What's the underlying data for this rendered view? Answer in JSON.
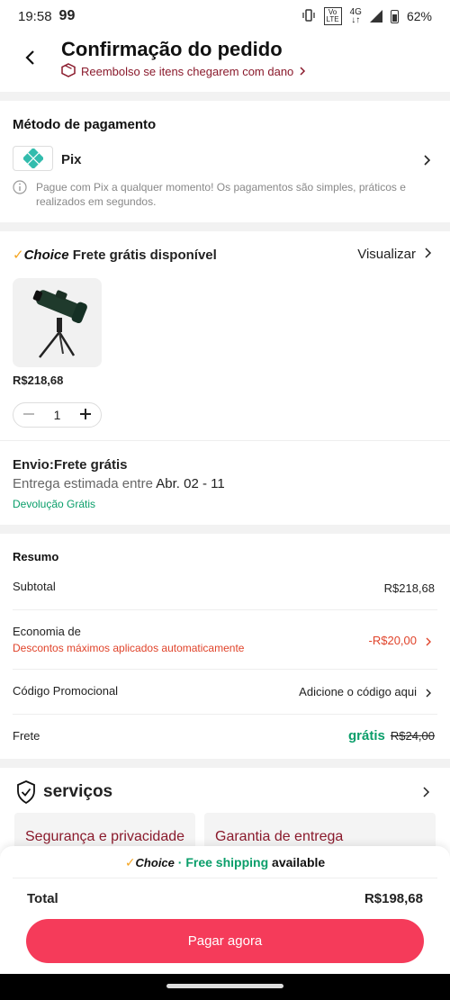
{
  "status_bar": {
    "time": "19:58",
    "app_badge": "99",
    "volte_top": "Vo",
    "volte_bottom": "LTE",
    "network": "4G",
    "battery": "62%"
  },
  "header": {
    "title": "Confirmação do pedido",
    "subtitle": "Reembolso se itens chegarem com dano"
  },
  "payment": {
    "section_title": "Método de pagamento",
    "method": "Pix",
    "info": "Pague com Pix a qualquer momento! Os pagamentos são simples, práticos e realizados em segundos."
  },
  "shipping_offer": {
    "choice_label": "Choice",
    "title": "Frete grátis disponível",
    "view_label": "Visualizar",
    "product_price": "R$218,68",
    "quantity": "1",
    "delivery_title": "Envio:Frete grátis",
    "estimate_label": "Entrega estimada entre",
    "estimate_dates": "Abr. 02 - 11",
    "free_return": "Devolução Grátis"
  },
  "summary": {
    "title": "Resumo",
    "subtotal_label": "Subtotal",
    "subtotal_value": "R$218,68",
    "savings_label": "Economia de",
    "savings_note": "Descontos máximos aplicados automaticamente",
    "savings_value": "-R$20,00",
    "promo_label": "Código Promocional",
    "promo_value": "Adicione o código aqui",
    "shipping_label": "Frete",
    "shipping_free": "grátis",
    "shipping_original": "R$24,00"
  },
  "services": {
    "title": "serviços",
    "cards": [
      "Segurança e privacidade",
      "Garantia de entrega"
    ]
  },
  "footer": {
    "choice_label": "Choice",
    "separator": "·",
    "free_shipping": "Free shipping",
    "available": "available",
    "total_label": "Total",
    "total_value": "R$198,68",
    "pay_button": "Pagar agora"
  },
  "colors": {
    "accent_red": "#f53b5a",
    "brand_dark_red": "#8a1a2c",
    "discount_red": "#e0432a",
    "green": "#0a9e6a",
    "choice_orange": "#f5a623"
  }
}
